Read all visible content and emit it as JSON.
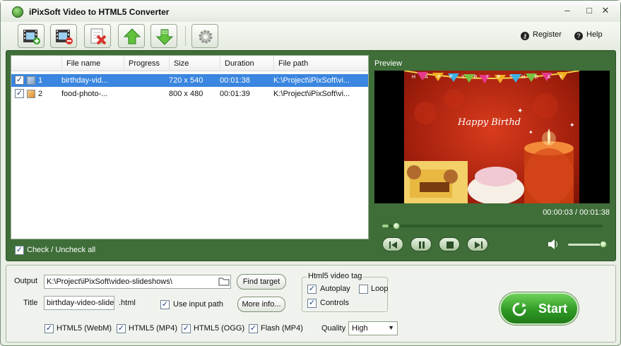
{
  "window": {
    "title": "iPixSoft Video to HTML5 Converter",
    "minimize": "–",
    "maximize": "□",
    "close": "✕"
  },
  "toolbar": {
    "links": {
      "register": "Register",
      "help": "Help"
    }
  },
  "file_list": {
    "columns": [
      "File name",
      "Progress",
      "Size",
      "Duration",
      "File path"
    ],
    "rows": [
      {
        "index": "1",
        "name": "birthday-vid...",
        "progress": "",
        "size": "720 x 540",
        "duration": "00:01:38",
        "path": "K:\\Project\\iPixSoft\\vi...",
        "checked": true,
        "selected": true
      },
      {
        "index": "2",
        "name": "food-photo-...",
        "progress": "",
        "size": "800 x 480",
        "duration": "00:01:39",
        "path": "K:\\Project\\iPixSoft\\vi...",
        "checked": true,
        "selected": false
      }
    ],
    "check_all_label": "Check / Uncheck all"
  },
  "preview": {
    "label": "Preview",
    "banner": "HAPPYBIRTHDAY",
    "caption": "Happy Birthd",
    "time": "00:00:03 / 00:01:38",
    "progress_fraction": 0.03,
    "volume_fraction": 1.0
  },
  "output": {
    "output_label": "Output",
    "output_path": "K:\\Project\\iPixSoft\\video-slideshows\\",
    "find_target": "Find target",
    "title_label": "Title",
    "title_value": "birthday-video-slide",
    "ext": ".html",
    "use_input_path": "Use input path",
    "more_info": "More info...",
    "tag_group": "Html5 video tag",
    "autoplay": "Autoplay",
    "loop": "Loop",
    "controls": "Controls",
    "formats": [
      "HTML5 (WebM)",
      "HTML5 (MP4)",
      "HTML5 (OGG)",
      "Flash (MP4)"
    ],
    "quality_label": "Quality",
    "quality_value": "High",
    "start": "Start"
  },
  "colors": {
    "panel": "#3f6e39",
    "accent": "#2f9a25",
    "selection": "#3a86e0"
  }
}
